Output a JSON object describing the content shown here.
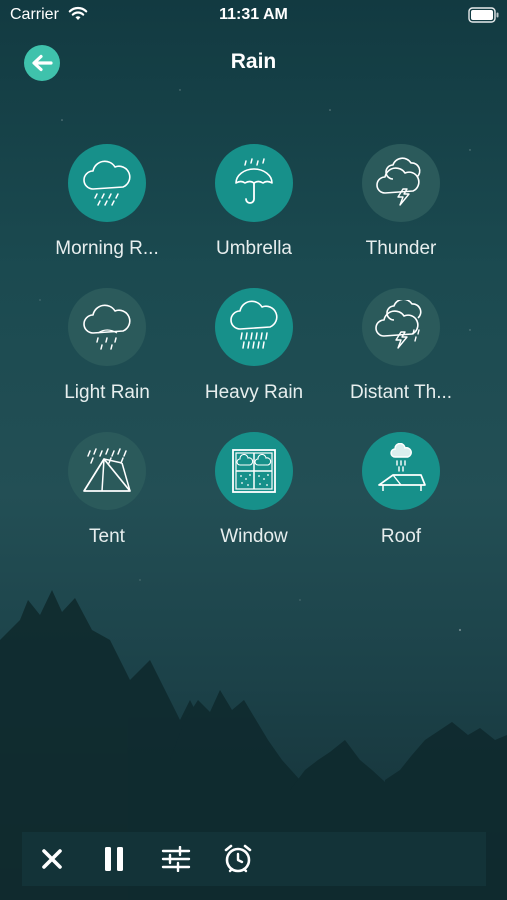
{
  "status_bar": {
    "carrier": "Carrier",
    "time": "11:31 AM",
    "wifi_icon": "wifi-icon",
    "battery_icon": "battery-icon"
  },
  "nav": {
    "title": "Rain",
    "back_icon": "arrow-left-icon"
  },
  "colors": {
    "accent": "#3fc2ac",
    "tile_active": "#17908a",
    "tile_inactive": "#2b5a5b",
    "background": "#1b4a50"
  },
  "sounds": [
    {
      "label": "Morning R...",
      "icon": "cloud-drizzle-icon",
      "active": true
    },
    {
      "label": "Umbrella",
      "icon": "umbrella-rain-icon",
      "active": true
    },
    {
      "label": "Thunder",
      "icon": "cloud-lightning-icon",
      "active": false
    },
    {
      "label": "Light Rain",
      "icon": "cloud-light-rain-icon",
      "active": false
    },
    {
      "label": "Heavy Rain",
      "icon": "cloud-heavy-rain-icon",
      "active": true
    },
    {
      "label": "Distant Th...",
      "icon": "cloud-distant-thunder-icon",
      "active": false
    },
    {
      "label": "Tent",
      "icon": "tent-rain-icon",
      "active": false
    },
    {
      "label": "Window",
      "icon": "window-rain-icon",
      "active": true
    },
    {
      "label": "Roof",
      "icon": "roof-rain-icon",
      "active": true
    }
  ],
  "toolbar": {
    "close_icon": "close-icon",
    "pause_icon": "pause-icon",
    "mixer_icon": "sliders-icon",
    "timer_icon": "alarm-clock-icon"
  }
}
